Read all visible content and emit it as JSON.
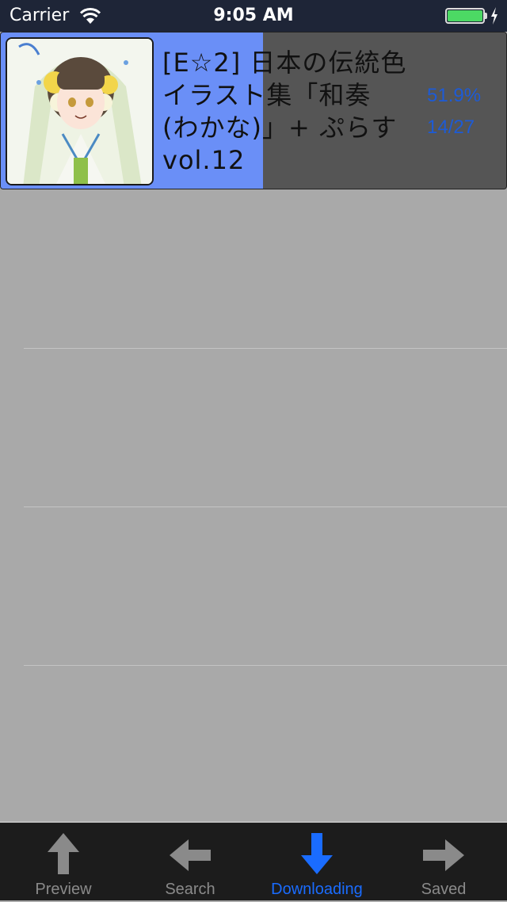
{
  "status_bar": {
    "carrier": "Carrier",
    "time": "9:05 AM",
    "battery_level": 1.0,
    "charging": true,
    "wifi_icon": "wifi-icon",
    "battery_icon": "battery-icon",
    "bolt_icon": "charging-bolt-icon"
  },
  "downloads": [
    {
      "title": "[E☆2] 日本の伝統色イラスト集「和奏(わかな)」+ ぷらす vol.12",
      "title_lines": [
        "[E☆2] 日本の伝統色",
        "イラスト集「和奏",
        "(わかな)」+ ぷらす",
        "vol.12"
      ],
      "progress_percent": 51.9,
      "progress_label": "51.9%",
      "pages_label": "14/27",
      "thumbnail": "anime-girl-white-kimono-thumbnail"
    }
  ],
  "empty_rows": 4,
  "tabbar": {
    "tabs": [
      {
        "label": "Preview",
        "icon": "arrow-up-icon",
        "active": false
      },
      {
        "label": "Search",
        "icon": "arrow-left-icon",
        "active": false
      },
      {
        "label": "Downloading",
        "icon": "arrow-down-icon",
        "active": true
      },
      {
        "label": "Saved",
        "icon": "arrow-right-icon",
        "active": false
      }
    ]
  },
  "colors": {
    "accent": "#1a6cff",
    "progress_fill": "#6a8ff7",
    "progress_text": "#1d5bd6",
    "status_bar_bg": "#1e2537",
    "list_bg": "#a9a9a9",
    "tabbar_bg": "#1c1c1c"
  }
}
